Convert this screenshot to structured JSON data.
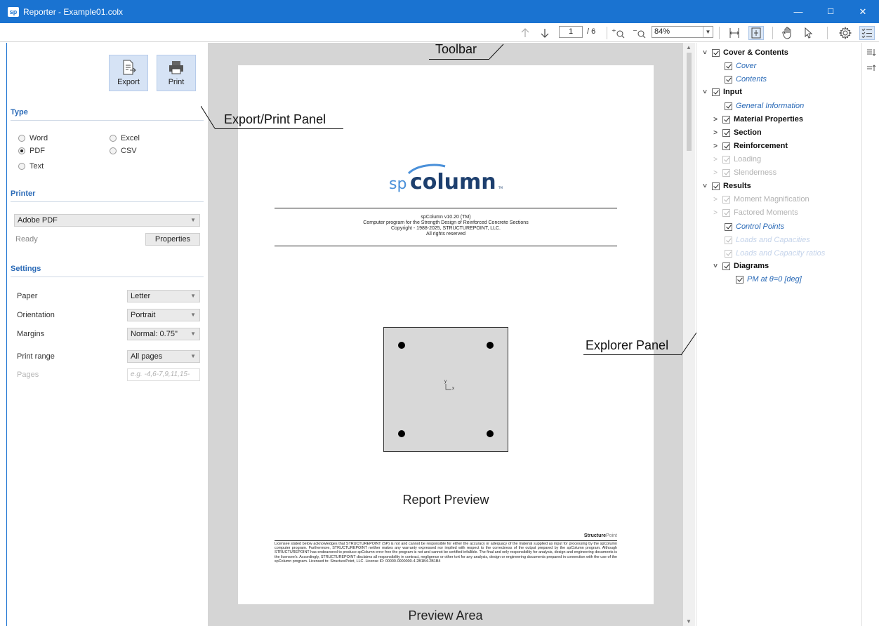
{
  "window": {
    "logo": "sp",
    "title": "Reporter - Example01.colx",
    "minimize": "—",
    "maximize": "☐",
    "close": "✕"
  },
  "toolbar": {
    "page_current": "1",
    "page_total": "/ 6",
    "zoom": "84%",
    "icons": [
      "arrow-up-icon",
      "arrow-down-icon",
      "zoom-in-icon",
      "zoom-out-icon",
      "fit-width-icon",
      "fit-page-icon",
      "hand-icon",
      "pointer-icon",
      "gear-icon",
      "checklist-icon"
    ]
  },
  "left": {
    "export_label": "Export",
    "print_label": "Print",
    "type_title": "Type",
    "types": [
      {
        "label": "Word",
        "selected": false
      },
      {
        "label": "Excel",
        "selected": false
      },
      {
        "label": "PDF",
        "selected": true
      },
      {
        "label": "CSV",
        "selected": false
      },
      {
        "label": "Text",
        "selected": false
      }
    ],
    "printer_title": "Printer",
    "printer_value": "Adobe PDF",
    "status": "Ready",
    "properties_label": "Properties",
    "settings_title": "Settings",
    "paper_label": "Paper",
    "paper_value": "Letter",
    "orientation_label": "Orientation",
    "orientation_value": "Portrait",
    "margins_label": "Margins",
    "margins_value": "Normal: 0.75\"",
    "print_range_label": "Print range",
    "print_range_value": "All pages",
    "pages_label": "Pages",
    "pages_placeholder": "e.g. -4,6-7,9,11,15-"
  },
  "preview": {
    "logo_sp": "sp",
    "logo_column": "column",
    "logo_tm": "TM",
    "cover_lines": [
      "spColumn v10.20 (TM)",
      "Computer program for the Strength Design of Reinforced Concrete Sections",
      "Copyright - 1988-2025, STRUCTUREPOINT, LLC.",
      "All rights reserved"
    ],
    "axis_y": "y",
    "axis_x": "x",
    "brand_bold": "Structure",
    "brand_light": "Point",
    "disclaimer": "Licensee stated below acknowledges that STRUCTUREPOINT (SP) is not and cannot be responsible for either the accuracy or adequacy of the material supplied as input for processing by the spColumn computer program. Furthermore, STRUCTUREPOINT neither makes any warranty expressed nor implied with respect to the correctness of the output prepared by the spColumn program. Although STRUCTUREPOINT has endeavored to produce spColumn error free the program is not and cannot be certified infallible. The final and only responsibility for analysis, design and engineering documents is the licensee's. Accordingly, STRUCTUREPOINT disclaims all responsibility in contract, negligence or other tort for any analysis, design or engineering documents prepared in connection with the use of the spColumn program. Licensed to: StructurePoint, LLC. License ID: 00000-0000000-4-2B1B4-2B1B4"
  },
  "explorer": {
    "items": [
      {
        "label": "Cover & Contents",
        "style": "bold",
        "level": 0,
        "chev": "˅"
      },
      {
        "label": "Cover",
        "style": "link",
        "level": 1,
        "chev": ""
      },
      {
        "label": "Contents",
        "style": "link",
        "level": 1,
        "chev": ""
      },
      {
        "label": "Input",
        "style": "bold",
        "level": 0,
        "chev": "˅"
      },
      {
        "label": "General Information",
        "style": "link",
        "level": 1,
        "chev": ""
      },
      {
        "label": "Material Properties",
        "style": "bold",
        "level": 1,
        "chev": ">"
      },
      {
        "label": "Section",
        "style": "bold",
        "level": 1,
        "chev": ">"
      },
      {
        "label": "Reinforcement",
        "style": "bold",
        "level": 1,
        "chev": ">"
      },
      {
        "label": "Loading",
        "style": "dis",
        "level": 1,
        "chev": ">"
      },
      {
        "label": "Slenderness",
        "style": "dis",
        "level": 1,
        "chev": ">"
      },
      {
        "label": "Results",
        "style": "bold",
        "level": 0,
        "chev": "˅"
      },
      {
        "label": "Moment Magnification",
        "style": "dis",
        "level": 1,
        "chev": ">"
      },
      {
        "label": "Factored Moments",
        "style": "dis",
        "level": 1,
        "chev": ">"
      },
      {
        "label": "Control Points",
        "style": "link",
        "level": 1,
        "chev": ""
      },
      {
        "label": "Loads and Capacities",
        "style": "disit",
        "level": 1,
        "chev": ""
      },
      {
        "label": "Loads and Capacity ratios",
        "style": "disit",
        "level": 1,
        "chev": ""
      },
      {
        "label": "Diagrams",
        "style": "bold",
        "level": 1,
        "chev": "˅"
      },
      {
        "label": "PM at θ=0 [deg]",
        "style": "link",
        "level": 2,
        "chev": ""
      }
    ]
  },
  "annotations": {
    "toolbar": "Toolbar",
    "export_print": "Export/Print Panel",
    "explorer": "Explorer Panel",
    "report_preview": "Report Preview",
    "preview_area": "Preview Area"
  }
}
